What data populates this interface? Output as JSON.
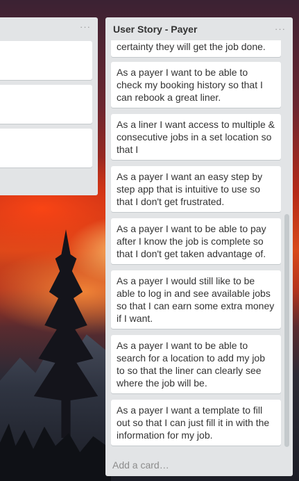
{
  "left_list": {
    "menu_label": "···"
  },
  "list": {
    "title": "User Story - Payer",
    "menu_label": "···",
    "add_card_label": "Add a card…",
    "cards": [
      {
        "text": "certainty they will get the job done."
      },
      {
        "text": "As a payer I want to be able to check my booking history so that I can rebook a great liner."
      },
      {
        "text": "As a liner I want access to multiple & consecutive jobs in a set location so that I"
      },
      {
        "text": "As a payer I want an easy step by step app that is intuitive to use so that I don't get frustrated."
      },
      {
        "text": "As a payer I want to be able to pay after I know the job is complete so that I don't get taken advantage of."
      },
      {
        "text": "As a payer I would still like to be able to log in and see available jobs so that I can earn some extra money if I want."
      },
      {
        "text": "As a payer I want to be able to search for a location to add my job to so that the liner can clearly see where the job will be."
      },
      {
        "text": "As a payer I want a template to fill out so that I can just fill it in with the information for my job."
      }
    ]
  }
}
